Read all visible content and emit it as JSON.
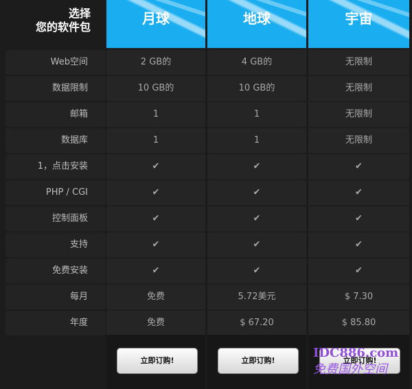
{
  "header": {
    "corner_line1": "选择",
    "corner_line2": "您的软件包",
    "plans": [
      "月球",
      "地球",
      "宇宙"
    ]
  },
  "rows": [
    {
      "label": "Web空间",
      "values": [
        "2 GB的",
        "4 GB的",
        "无限制"
      ]
    },
    {
      "label": "数据限制",
      "values": [
        "10 GB的",
        "10 GB的",
        "无限制"
      ]
    },
    {
      "label": "邮箱",
      "values": [
        "1",
        "1",
        "无限制"
      ]
    },
    {
      "label": "数据库",
      "values": [
        "1",
        "1",
        "无限制"
      ]
    },
    {
      "label": "1，点击安装",
      "values": [
        "✔",
        "✔",
        "✔"
      ]
    },
    {
      "label": "PHP / CGI",
      "values": [
        "✔",
        "✔",
        "✔"
      ]
    },
    {
      "label": "控制面板",
      "values": [
        "✔",
        "✔",
        "✔"
      ]
    },
    {
      "label": "支持",
      "values": [
        "✔",
        "✔",
        "✔"
      ]
    },
    {
      "label": "免费安装",
      "values": [
        "✔",
        "✔",
        "✔"
      ]
    },
    {
      "label": "每月",
      "values": [
        "免费",
        "5.72美元",
        "$ 7.30"
      ]
    },
    {
      "label": "年度",
      "values": [
        "免费",
        "$ 67.20",
        "$ 85.80"
      ]
    }
  ],
  "buttons": [
    "立即订购!",
    "立即订购!",
    "立即订购!"
  ],
  "watermark": {
    "line1": "IDC886.com",
    "line2": "免费国外空间"
  },
  "colors": {
    "accent": "#1aaef0",
    "check": "#35c4f2",
    "background": "#1c1c1c"
  }
}
